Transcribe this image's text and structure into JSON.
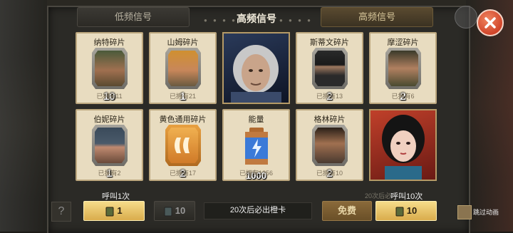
{
  "header": {
    "title": "高频信号",
    "tab_left": "低频信号",
    "tab_right": "高频信号"
  },
  "cards_row1": [
    {
      "title": "纳特碎片",
      "count": "10",
      "owned": "已拥有11"
    },
    {
      "title": "山姆碎片",
      "count": "1",
      "owned": "已拥有21"
    },
    {
      "title": "",
      "count": "",
      "owned": ""
    },
    {
      "title": "斯蒂文碎片",
      "count": "2",
      "owned": "已拥有13"
    },
    {
      "title": "摩涩碎片",
      "count": "2",
      "owned": "已拥有6"
    }
  ],
  "cards_row2": [
    {
      "title": "伯妮碎片",
      "count": "1",
      "owned": "已拥有2"
    },
    {
      "title": "黄色通用碎片",
      "count": "2",
      "owned": "已拥有17"
    },
    {
      "title": "能量",
      "count": "1000",
      "owned": "已拥有1256"
    },
    {
      "title": "格林碎片",
      "count": "2",
      "owned": "已拥有10"
    },
    {
      "title": "",
      "count": "",
      "owned": ""
    }
  ],
  "bottom": {
    "call_once_label": "呼叫1次",
    "call_once_cost": "1",
    "call_once_alt_cost": "10",
    "guarantee_text": "20次后必出橙卡",
    "call_ten_label": "呼叫10次",
    "call_ten_hint": "20次后必",
    "free_label": "免费",
    "call_ten_cost": "10",
    "skip_anim_label": "跳过动画",
    "help_symbol": "?"
  },
  "colors": {
    "card_bg": "#e8dcc0",
    "gold_button": "#e8c26a",
    "close_red": "#d0452a"
  }
}
